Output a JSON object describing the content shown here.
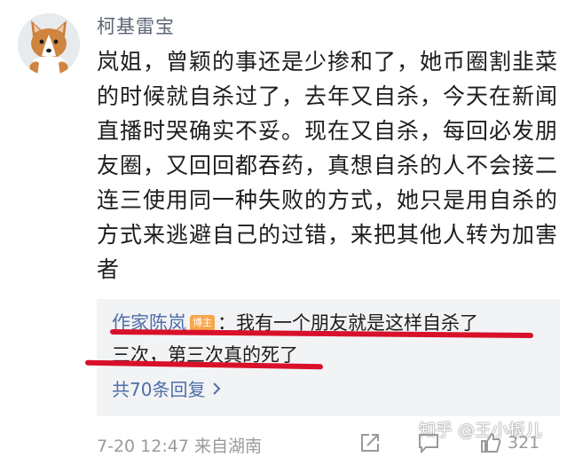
{
  "comment": {
    "username": "柯基雷宝",
    "text": "岚姐，曾颖的事还是少掺和了，她币圈割韭菜的时候就自杀过了，去年又自杀，今天在新闻直播时哭确实不妥。现在又自杀，每回必发朋友圈，又回回都吞药，真想自杀的人不会接二连三使用同一种失败的方式，她只是用自杀的方式来逃避自己的过错，来把其他人转为加害者",
    "meta": "7-20 12:47  来自湖南",
    "like_count": "321"
  },
  "reply": {
    "author": "作家陈岚",
    "badge": "博主",
    "separator": "：",
    "text_line1": "我有一个朋友就是这样自杀了",
    "text_line2": "三次，第三次真的死了",
    "count_label": "共70条回复"
  },
  "watermark": "知乎 @王小板儿",
  "colors": {
    "link_blue": "#4e6ea8",
    "underline_red": "#d8102a",
    "badge_orange": "#f7a64a",
    "reply_bg": "#f2f3f5"
  },
  "icons": {
    "share": "share-icon",
    "comment": "comment-icon",
    "like": "like-icon",
    "chevron": "chevron-right-icon"
  }
}
